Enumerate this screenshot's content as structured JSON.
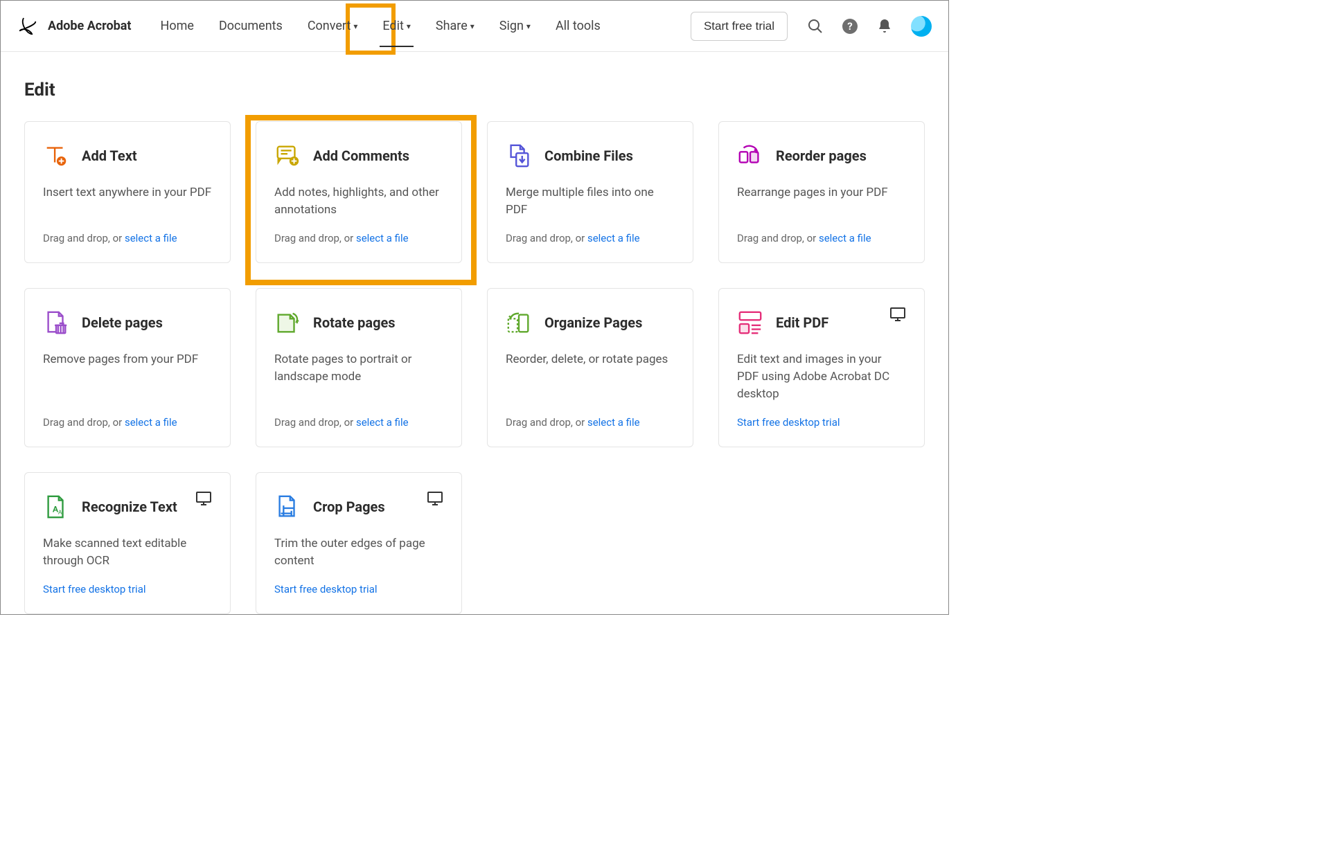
{
  "brand": "Adobe Acrobat",
  "nav": {
    "home": "Home",
    "documents": "Documents",
    "convert": "Convert",
    "edit": "Edit",
    "share": "Share",
    "sign": "Sign",
    "alltools": "All tools"
  },
  "trial_button": "Start free trial",
  "page_title": "Edit",
  "dragdrop_prefix": "Drag and drop, or ",
  "select_file": "select a file",
  "desktop_trial": "Start free desktop trial",
  "cards": {
    "add_text": {
      "title": "Add Text",
      "desc": "Insert text anywhere in your PDF"
    },
    "add_comments": {
      "title": "Add Comments",
      "desc": "Add notes, highlights, and other annotations"
    },
    "combine": {
      "title": "Combine Files",
      "desc": "Merge multiple files into one PDF"
    },
    "reorder": {
      "title": "Reorder pages",
      "desc": "Rearrange pages in your PDF"
    },
    "delete": {
      "title": "Delete pages",
      "desc": "Remove pages from your PDF"
    },
    "rotate": {
      "title": "Rotate pages",
      "desc": "Rotate pages to portrait or landscape mode"
    },
    "organize": {
      "title": "Organize Pages",
      "desc": "Reorder, delete, or rotate pages"
    },
    "editpdf": {
      "title": "Edit PDF",
      "desc": "Edit text and images in your PDF using Adobe Acrobat DC desktop"
    },
    "recognize": {
      "title": "Recognize Text",
      "desc": "Make scanned text editable through OCR"
    },
    "crop": {
      "title": "Crop Pages",
      "desc": "Trim the outer edges of page content"
    }
  }
}
